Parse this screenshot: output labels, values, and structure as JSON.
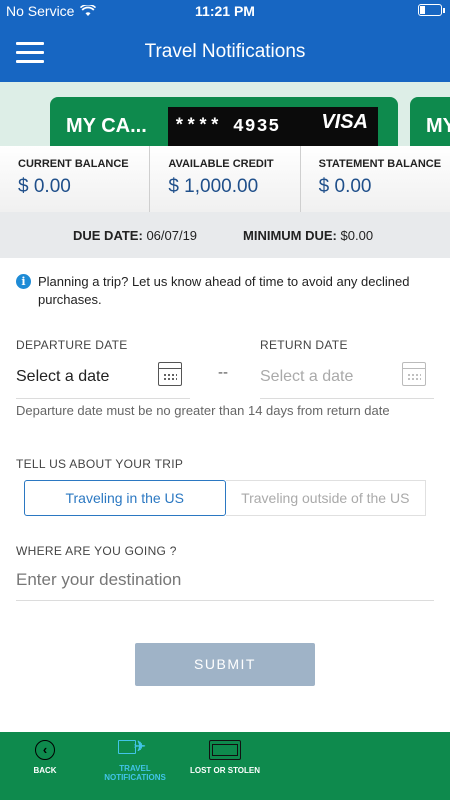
{
  "status_bar": {
    "carrier": "No Service",
    "time": "11:21 PM"
  },
  "nav": {
    "title": "Travel Notifications"
  },
  "cards": [
    {
      "name": "MY CA...",
      "number": "**** 4935",
      "brand": "VISA"
    },
    {
      "name": "MY"
    }
  ],
  "balances": [
    {
      "label": "CURRENT BALANCE",
      "value": "$ 0.00"
    },
    {
      "label": "AVAILABLE CREDIT",
      "value": "$ 1,000.00"
    },
    {
      "label": "STATEMENT BALANCE",
      "value": "$ 0.00"
    }
  ],
  "due": {
    "date_label": "DUE DATE:",
    "date_value": "06/07/19",
    "min_label": "MINIMUM DUE:",
    "min_value": "$0.00"
  },
  "info": {
    "text": "Planning a trip? Let us know ahead of time to avoid any declined purchases."
  },
  "form": {
    "departure_label": "DEPARTURE DATE",
    "departure_value": "Select a date",
    "return_label": "RETURN DATE",
    "return_placeholder": "Select a date",
    "separator": "--",
    "hint": "Departure date must be no greater than 14 days from return date",
    "trip_label": "TELL US ABOUT YOUR TRIP",
    "trip_options": [
      "Traveling in the US",
      "Traveling outside of the US"
    ],
    "destination_label": "WHERE ARE YOU GOING ?",
    "destination_placeholder": "Enter your destination",
    "submit": "SUBMIT"
  },
  "tabs": [
    {
      "label": "BACK"
    },
    {
      "label": "TRAVEL NOTIFICATIONS"
    },
    {
      "label": "LOST OR STOLEN"
    }
  ],
  "colors": {
    "primary": "#1766c2",
    "green": "#0e8a4d",
    "accent": "#2b78c2",
    "active_tab": "#42c4e8"
  }
}
